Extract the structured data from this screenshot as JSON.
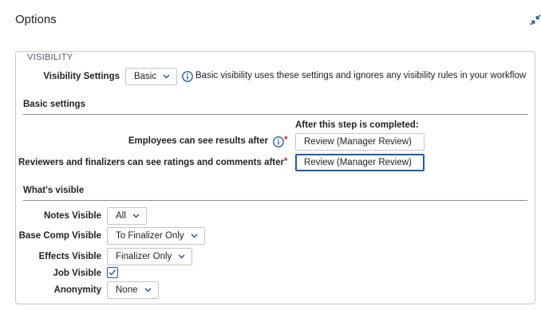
{
  "header": {
    "title": "Options",
    "collapse_icon": "collapse-arrows-icon"
  },
  "visibility": {
    "legend": "VISIBILITY",
    "settings_label": "Visibility Settings",
    "settings_value": "Basic",
    "info_text": "Basic visibility uses these settings and ignores any visibility rules in your workflow"
  },
  "basic_settings": {
    "title": "Basic settings",
    "after_step_label": "After this step is completed:",
    "employees_label": "Employees can see results after",
    "employees_value": "Review (Manager Review)",
    "reviewers_label": "Reviewers and finalizers can see ratings and comments after",
    "reviewers_value": "Review (Manager Review)",
    "required_mark": "*"
  },
  "whats_visible": {
    "title": "What's visible",
    "notes_label": "Notes Visible",
    "notes_value": "All",
    "base_comp_label": "Base Comp Visible",
    "base_comp_value": "To Finalizer Only",
    "effects_label": "Effects Visible",
    "effects_value": "Finalizer Only",
    "job_label": "Job Visible",
    "job_checked": true,
    "anonymity_label": "Anonymity",
    "anonymity_value": "None"
  },
  "colors": {
    "accent": "#1f5aa6",
    "required": "#c0271c",
    "border": "#c9c9c9"
  }
}
